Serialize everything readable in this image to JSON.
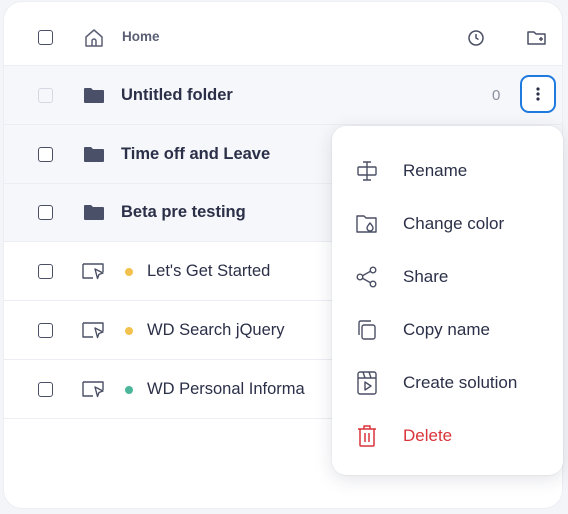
{
  "header": {
    "home_label": "Home"
  },
  "rows": [
    {
      "name": "Untitled folder",
      "type": "folder",
      "count": "0"
    },
    {
      "name": "Time off and Leave",
      "type": "folder"
    },
    {
      "name": "Beta pre testing",
      "type": "folder"
    },
    {
      "name": "Let's Get Started",
      "type": "flow",
      "status_color": "#f2c14e"
    },
    {
      "name": "WD Search jQuery",
      "type": "flow",
      "status_color": "#f2c14e"
    },
    {
      "name": "WD Personal Informa",
      "type": "flow",
      "status_color": "#4bb69a"
    }
  ],
  "menu": {
    "items": [
      {
        "label": "Rename",
        "icon": "rename-icon"
      },
      {
        "label": "Change color",
        "icon": "color-folder-icon"
      },
      {
        "label": "Share",
        "icon": "share-icon"
      },
      {
        "label": "Copy name",
        "icon": "copy-icon"
      },
      {
        "label": "Create solution",
        "icon": "solution-icon"
      },
      {
        "label": "Delete",
        "icon": "trash-icon",
        "danger": true
      }
    ]
  },
  "colors": {
    "accent": "#1f7ae0",
    "danger": "#d9343a",
    "folder": "#4a5068"
  }
}
